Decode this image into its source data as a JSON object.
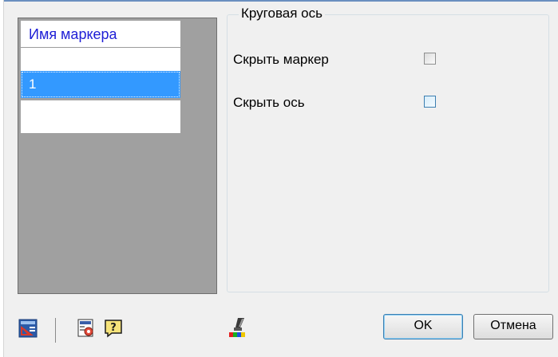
{
  "list": {
    "header": "Имя маркера",
    "rows": [
      "1"
    ]
  },
  "group": {
    "title": "Круговая ось",
    "options": [
      {
        "label": "Скрыть маркер",
        "checked": false
      },
      {
        "label": "Скрыть ось",
        "checked": false
      }
    ]
  },
  "toolbar": {
    "icons": [
      "layout-icon",
      "sheet-settings-icon",
      "help-icon",
      "brush-color-icon"
    ]
  },
  "buttons": {
    "ok": "OK",
    "cancel": "Отмена"
  },
  "colors": {
    "selection": "#3399ff",
    "header_text": "#1f1fd6",
    "list_background": "#a0a0a0"
  }
}
